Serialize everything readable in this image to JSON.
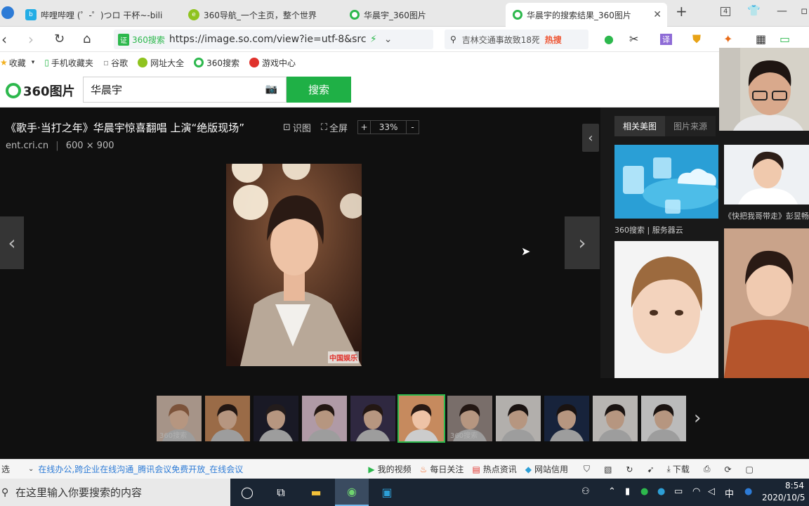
{
  "browser": {
    "tabs": [
      {
        "title": "哔哩哔哩 (゜-゜)つロ 干杯~-bili",
        "icon": "bilibili-icon",
        "active": false
      },
      {
        "title": "360导航_一个主页，整个世界",
        "icon": "360nav-icon",
        "active": false
      },
      {
        "title": "华晨宇_360图片",
        "icon": "360-icon",
        "active": false
      },
      {
        "title": "华晨宇的搜索结果_360图片",
        "icon": "360-icon",
        "active": true
      }
    ],
    "new_tab": "+",
    "tab_count": "4",
    "address": {
      "secure_badge": "证",
      "brand": "360搜索",
      "url": "https://image.so.com/view?ie=utf-8&src"
    },
    "search_box": {
      "text": "吉林交通事故致18死",
      "hot": "热搜"
    },
    "bookmarks": [
      "收藏",
      "手机收藏夹",
      "谷歌",
      "网址大全",
      "360搜索",
      "游戏中心"
    ]
  },
  "site": {
    "logo": "360图片",
    "query": "华晨宇",
    "search_button": "搜索"
  },
  "viewer": {
    "title": "《歌手·当打之年》华晨宇惊喜翻唱 上演“绝版现场”",
    "tool_identify": "识图",
    "tool_fullscreen": "全屏",
    "zoom_minus": "-",
    "zoom_plus": "+",
    "zoom": "33%",
    "source": "ent.cri.cn",
    "dimensions": "600 × 900",
    "watermark": "中国娱乐"
  },
  "side": {
    "tabs": [
      "相关美图",
      "图片来源"
    ],
    "captions": [
      "360搜索 | 服务器云",
      "《快把我哥带走》彭昱畅"
    ]
  },
  "filmstrip": {
    "count": 11,
    "selected_index": 5,
    "watermark": "360搜索"
  },
  "status": {
    "left_text": "选",
    "news": "在线办公,跨企业在线沟通_腾讯会议免费开放_在线会议",
    "items": [
      "我的视频",
      "每日关注",
      "热点资讯",
      "网站信用"
    ],
    "download": "下载"
  },
  "taskbar": {
    "search_placeholder": "在这里输入你要搜索的内容",
    "time": "8:54",
    "date": "2020/10/5",
    "ime": "中"
  },
  "colors": {
    "brand_green": "#1fb046",
    "viewer_bg": "#101010",
    "taskbar": "#1a2533"
  }
}
